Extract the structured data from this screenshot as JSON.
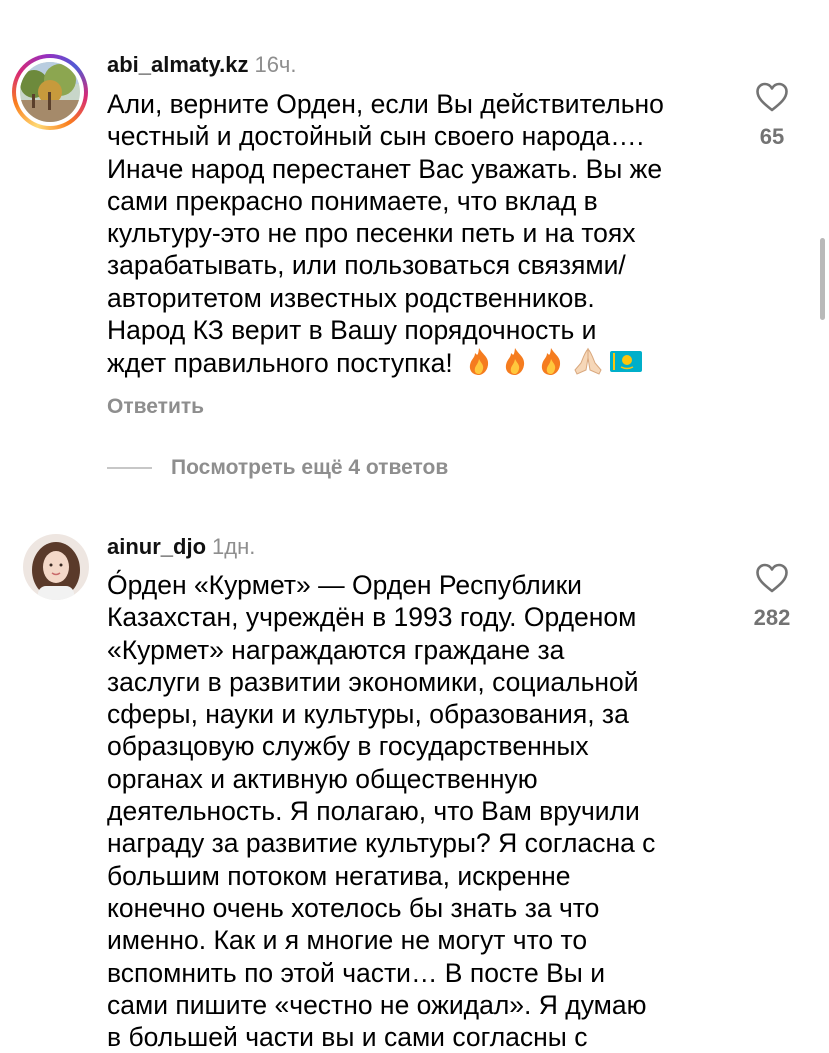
{
  "comments": [
    {
      "username": "abi_almaty.kz",
      "time": "16ч.",
      "text": "Али, верните Орден, если Вы действительно\nчестный и достойный сын своего народа….\nИначе народ перестанет Вас уважать. Вы же\nсами прекрасно понимаете, что вклад в\nкультуру-это не про песенки петь и на тоях\nзарабатывать, или пользоваться связями/\nавторитетом известных  родственников.\nНарод КЗ верит в Вашу порядочность и\nждет правильного поступка!",
      "emojis": [
        "fire-emoji",
        "fire-emoji",
        "fire-emoji",
        "folded-hands-emoji",
        "kazakhstan-flag-emoji"
      ],
      "likes": "65",
      "reply_label": "Ответить",
      "view_more_label": "Посмотреть ещё 4 ответов"
    },
    {
      "username": "ainur_djo",
      "time": "1дн.",
      "text": "О́рден «Курмет» — Орден Республики\nКазахстан, учреждён в 1993 году. Орденом\n«Курмет» награждаются граждане за\nзаслуги в развитии экономики, социальной\nсферы, науки и культуры, образования, за\nобразцовую службу в государственных\nорганах и активную общественную\nдеятельность. Я полагаю, что Вам вручили\nнаграду за развитие культуры? Я согласна с\nбольшим потоком негатива, искренне\nконечно очень хотелось бы знать за что\nименно. Как и я многие не могут что то\nвспомнить по этой части… В посте Вы и\nсами пишите «честно не ожидал». Я думаю\nв большей части вы и сами согласны с",
      "likes": "282"
    }
  ],
  "icons": {
    "like": "heart-outline-icon"
  },
  "colors": {
    "username": "#111111",
    "muted": "#8e8e8e",
    "like_count": "#737373",
    "story_ring": [
      "#feda75",
      "#fa7e1e",
      "#d62976",
      "#962fbf",
      "#4f5bd5"
    ]
  }
}
